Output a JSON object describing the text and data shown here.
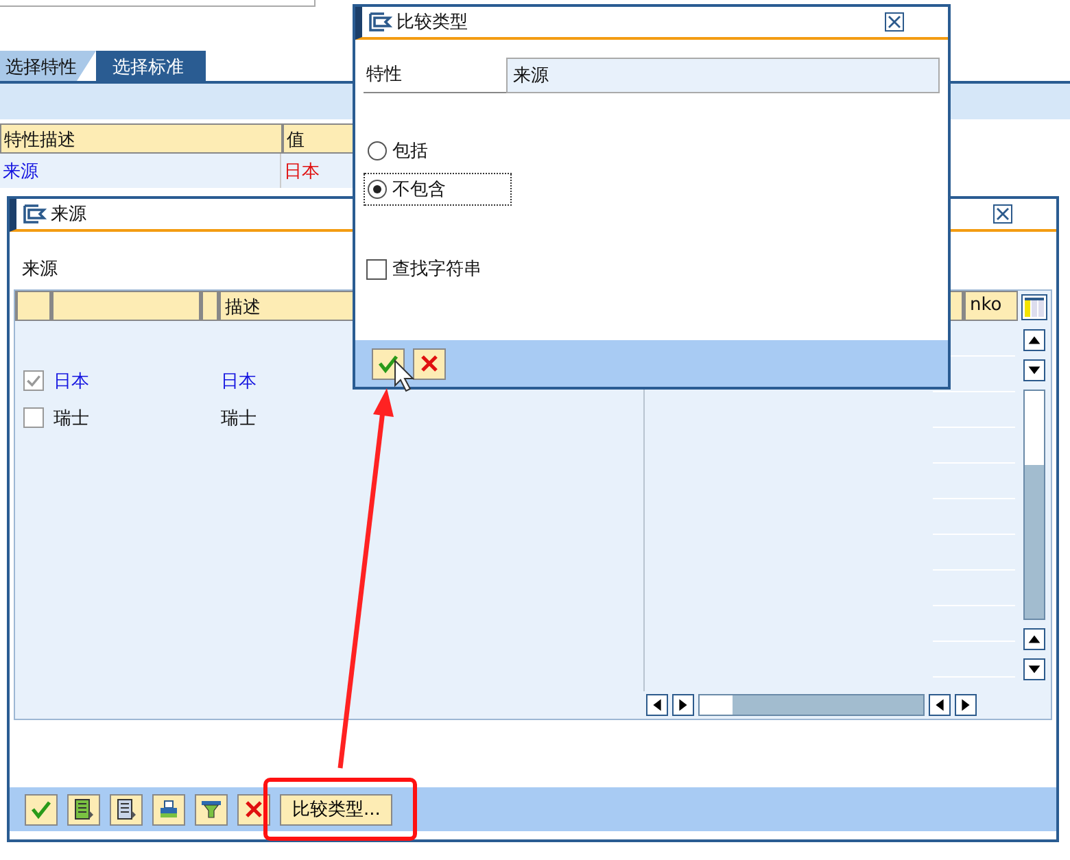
{
  "background": {
    "tabs": [
      {
        "label": "选择特性",
        "selected": false
      },
      {
        "label": "选择标准",
        "selected": true
      }
    ],
    "table": {
      "columns": [
        "特性描述",
        "值"
      ],
      "rows": [
        {
          "cells": [
            "来源",
            "日本"
          ]
        }
      ]
    }
  },
  "list_window": {
    "title": "来源",
    "label": "来源",
    "table": {
      "columns": [
        "描述",
        "nko"
      ],
      "rows": [
        {
          "checked": true,
          "highlighted": true,
          "key": "日本",
          "description": "日本"
        },
        {
          "checked": false,
          "highlighted": false,
          "key": "瑞士",
          "description": "瑞士"
        }
      ]
    },
    "toolbar": {
      "text_button": "比较类型..."
    }
  },
  "dialog": {
    "title": "比较类型",
    "field": {
      "label": "特性",
      "value": "来源"
    },
    "options": [
      {
        "label": "包括",
        "selected": false
      },
      {
        "label": "不包含",
        "selected": true
      }
    ],
    "checkbox": {
      "label": "查找字符串",
      "checked": false
    }
  }
}
